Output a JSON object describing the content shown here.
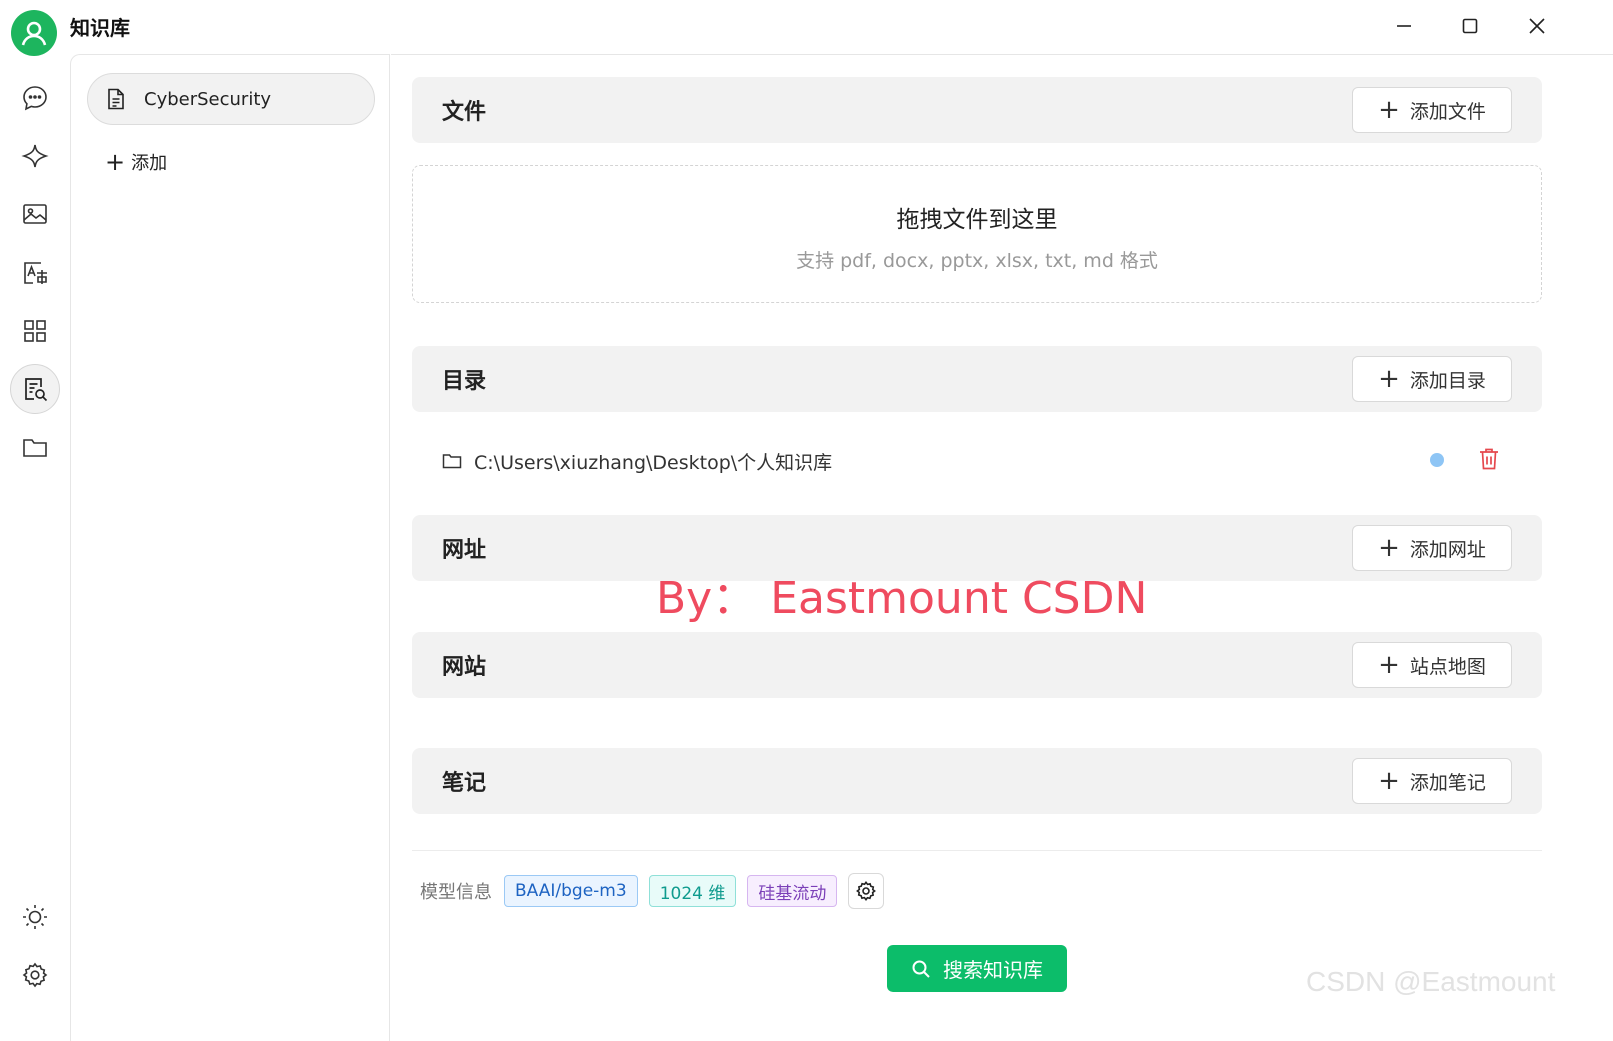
{
  "app": {
    "title": "知识库"
  },
  "window_controls": [
    "minimize-icon",
    "maximize-icon",
    "close-icon"
  ],
  "rail": {
    "icons": [
      "chat-icon",
      "sparkle-icon",
      "image-icon",
      "translate-icon",
      "apps-grid-icon",
      "knowledge-search-icon",
      "folder-icon"
    ],
    "bottom_icons": [
      "sun-icon",
      "gear-icon"
    ],
    "active": "knowledge-search-icon"
  },
  "kb_list": {
    "items": [
      {
        "label": "CyberSecurity"
      }
    ],
    "add_label": "添加"
  },
  "sections": {
    "files": {
      "title": "文件",
      "button": "添加文件"
    },
    "dropzone": {
      "title": "拖拽文件到这里",
      "subtitle": "支持 pdf, docx, pptx, xlsx, txt, md 格式"
    },
    "directory": {
      "title": "目录",
      "button": "添加目录",
      "items": [
        {
          "path": "C:\\Users\\xiuzhang\\Desktop\\个人知识库"
        }
      ]
    },
    "url": {
      "title": "网址",
      "button": "添加网址"
    },
    "website": {
      "title": "网站",
      "button": "站点地图"
    },
    "notes": {
      "title": "笔记",
      "button": "添加笔记"
    }
  },
  "model_info": {
    "label": "模型信息",
    "tags": {
      "model": "BAAI/bge-m3",
      "dims": "1024 维",
      "provider": "硅基流动"
    }
  },
  "search_button": "搜索知识库",
  "watermarks": {
    "overlay": "By：  Eastmount CSDN",
    "corner": "CSDN @Eastmount"
  },
  "colors": {
    "accent": "#0cbd6a",
    "avatar": "#1db55e",
    "danger": "#e5484d",
    "watermark": "#ef4b5f"
  }
}
